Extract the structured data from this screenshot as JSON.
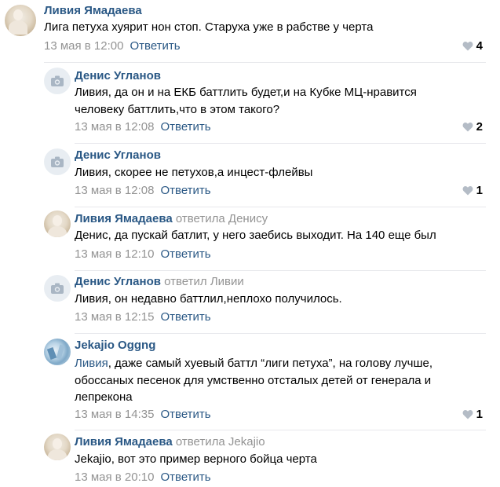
{
  "comments": [
    {
      "author": "Ливия Ямадаева",
      "replied_to": "",
      "lines": [
        "Лига петуха хуярит нон стоп. Старуха уже в рабстве у черта"
      ],
      "date": "13 мая в 12:00",
      "reply_label": "Ответить",
      "likes": "4",
      "avatar": "photo-avatar"
    },
    {
      "author": "Денис Угланов",
      "replied_to": "",
      "lines": [
        "Ливия, да он и на ЕКБ баттлить будет,и на Кубке МЦ-нравится",
        "человеку баттлить,что в этом такого?"
      ],
      "date": "13 мая в 12:08",
      "reply_label": "Ответить",
      "likes": "2",
      "avatar": "camera-icon"
    },
    {
      "author": "Денис Угланов",
      "replied_to": "",
      "lines": [
        "Ливия, скорее не петухов,а инцест-флейвы"
      ],
      "date": "13 мая в 12:08",
      "reply_label": "Ответить",
      "likes": "1",
      "avatar": "camera-icon"
    },
    {
      "author": "Ливия Ямадаева",
      "replied_to": "ответила Денису",
      "lines": [
        "Денис, да пускай батлит, у него заебись выходит. На 140 еще был"
      ],
      "date": "13 мая в 12:10",
      "reply_label": "Ответить",
      "likes": "",
      "avatar": "photo-avatar"
    },
    {
      "author": "Денис Угланов",
      "replied_to": "ответил Ливии",
      "lines": [
        "Ливия, он недавно баттлил,неплохо получилось."
      ],
      "date": "13 мая в 12:15",
      "reply_label": "Ответить",
      "likes": "",
      "avatar": "camera-icon"
    },
    {
      "author": "Jekajio Oggng",
      "replied_to": "",
      "mention": "Ливия",
      "lines": [
        ", даже самый хуевый баттл “лиги петуха”, на голову лучше,",
        "обоссаных песенок для умственно отсталых детей от генерала и",
        "лепрекона"
      ],
      "date": "13 мая в 14:35",
      "reply_label": "Ответить",
      "likes": "1",
      "avatar": "art-avatar"
    },
    {
      "author": "Ливия Ямадаева",
      "replied_to": "ответила Jekajio",
      "lines": [
        "Jekajio, вот это пример верного бойца черта"
      ],
      "date": "13 мая в 20:10",
      "reply_label": "Ответить",
      "likes": "",
      "avatar": "photo-avatar"
    }
  ],
  "colors": {
    "link": "#2a5885",
    "meta": "#939393",
    "divider": "#e7e8ec"
  }
}
